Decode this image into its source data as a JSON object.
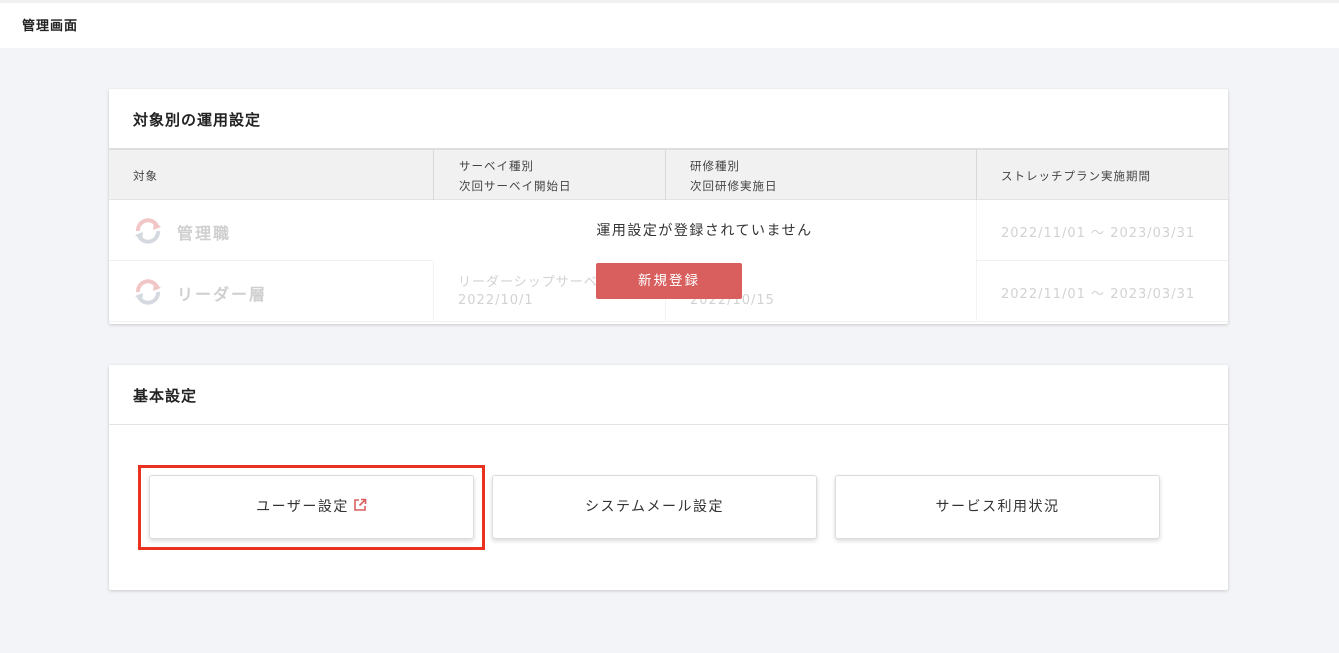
{
  "app": {
    "title": "管理画面"
  },
  "operation_settings": {
    "title": "対象別の運用設定",
    "columns": {
      "target": "対象",
      "survey_type": "サーベイ種別",
      "survey_next_start": "次回サーベイ開始日",
      "training_type": "研修種別",
      "training_next_date": "次回研修実施日",
      "stretch_period": "ストレッチプラン実施期間"
    },
    "rows": [
      {
        "target": "管理職",
        "survey_type": "",
        "survey_date": "",
        "training_date": "",
        "period": "2022/11/01 〜 2023/03/31"
      },
      {
        "target": "リーダー層",
        "survey_type": "リーダーシップサーベイ",
        "survey_date": "2022/10/1",
        "training_date": "2022/10/15",
        "period": "2022/11/01 〜 2023/03/31"
      }
    ],
    "empty_message": "運用設定が登録されていません",
    "new_button_label": "新規登録"
  },
  "basic_settings": {
    "title": "基本設定",
    "buttons": [
      {
        "label": "ユーザー設定",
        "icon": "external-link-icon"
      },
      {
        "label": "システムメール設定"
      },
      {
        "label": "サービス利用状況"
      }
    ]
  },
  "colors": {
    "accent": "#d95f5f",
    "highlight": "#e8311f",
    "background": "#f3f4f7"
  }
}
